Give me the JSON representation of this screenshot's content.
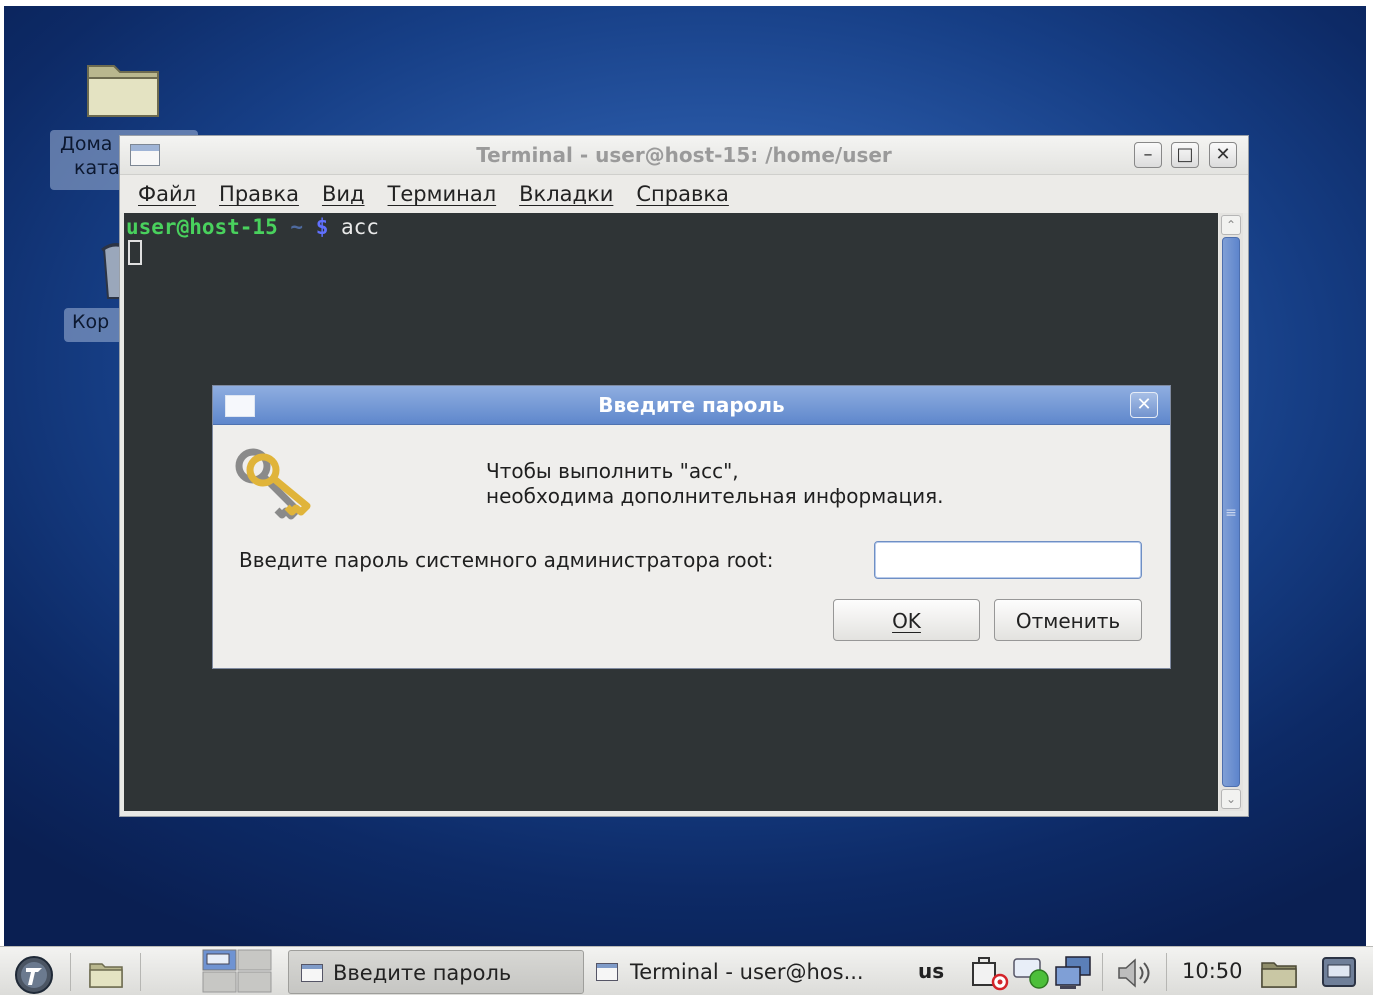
{
  "desktop": {
    "icons": [
      {
        "label_line1": "Дома",
        "label_line2": "ката",
        "icon": "folder-icon"
      },
      {
        "label": "Кор",
        "icon": "trash-icon"
      }
    ]
  },
  "terminal": {
    "title": "Terminal - user@host-15: /home/user",
    "window_buttons": {
      "minimize": "–",
      "maximize": "□",
      "close": "✕"
    },
    "menu": [
      "Файл",
      "Правка",
      "Вид",
      "Терминал",
      "Вкладки",
      "Справка"
    ],
    "prompt_user": "user@host-15",
    "prompt_dir": "~",
    "prompt_symbol": "$",
    "command": "acc"
  },
  "dialog": {
    "title": "Введите пароль",
    "message_line1": "Чтобы выполнить \"acc\",",
    "message_line2": "необходима дополнительная информация.",
    "password_label": "Введите пароль системного администратора root:",
    "password_value": "",
    "ok_label": "OK",
    "cancel_label": "Отменить",
    "close_glyph": "✕"
  },
  "taskbar": {
    "tasks": [
      {
        "label": "Введите пароль",
        "active": true
      },
      {
        "label": "Terminal - user@hos...",
        "active": false
      }
    ],
    "keyboard_layout": "us",
    "clock": "10:50"
  },
  "colors": {
    "dialog_titlebar": "#6f93d2",
    "terminal_bg": "#2f3436",
    "prompt_user": "#49d15d",
    "prompt_symbol": "#6070ff"
  }
}
